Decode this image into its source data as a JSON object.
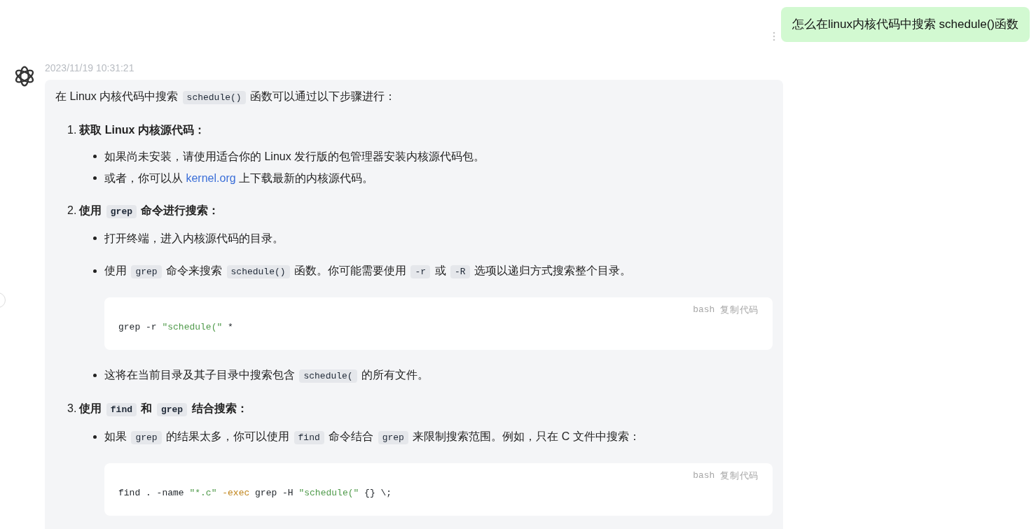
{
  "user_message": {
    "text": "怎么在linux内核代码中搜索 schedule()函数"
  },
  "assistant": {
    "timestamp": "2023/11/19 10:31:21",
    "intro": [
      {
        "kind": "text",
        "text": "在 Linux 内核代码中搜索 "
      },
      {
        "kind": "code",
        "text": "schedule()"
      },
      {
        "kind": "text",
        "text": " 函数可以通过以下步骤进行："
      }
    ],
    "steps": [
      {
        "number": "1.",
        "tight": true,
        "title": [
          {
            "kind": "text",
            "text": "获取 Linux 内核源代码："
          }
        ],
        "items": [
          {
            "kind": "bullet",
            "content": [
              {
                "kind": "text",
                "text": "如果尚未安装，请使用适合你的 Linux 发行版的包管理器安装内核源代码包。"
              }
            ]
          },
          {
            "kind": "bullet",
            "content": [
              {
                "kind": "text",
                "text": "或者，你可以从 "
              },
              {
                "kind": "link",
                "text": "kernel.org"
              },
              {
                "kind": "text",
                "text": " 上下载最新的内核源代码。"
              }
            ]
          }
        ]
      },
      {
        "number": "2.",
        "tight": false,
        "title": [
          {
            "kind": "text",
            "text": "使用 "
          },
          {
            "kind": "code",
            "text": "grep"
          },
          {
            "kind": "text",
            "text": " 命令进行搜索："
          }
        ],
        "items": [
          {
            "kind": "bullet",
            "content": [
              {
                "kind": "text",
                "text": "打开终端，进入内核源代码的目录。"
              }
            ]
          },
          {
            "kind": "bullet",
            "content": [
              {
                "kind": "text",
                "text": "使用 "
              },
              {
                "kind": "code",
                "text": "grep"
              },
              {
                "kind": "text",
                "text": " 命令来搜索 "
              },
              {
                "kind": "code",
                "text": "schedule()"
              },
              {
                "kind": "text",
                "text": " 函数。你可能需要使用 "
              },
              {
                "kind": "code",
                "text": "-r"
              },
              {
                "kind": "text",
                "text": " 或 "
              },
              {
                "kind": "code",
                "text": "-R"
              },
              {
                "kind": "text",
                "text": " 选项以递归方式搜索整个目录。"
              }
            ]
          },
          {
            "kind": "code_block",
            "language": "bash",
            "copy_label": "复制代码",
            "tokens": [
              {
                "kind": "plain",
                "text": "grep -r "
              },
              {
                "kind": "string",
                "text": "\"schedule(\""
              },
              {
                "kind": "plain",
                "text": " *"
              }
            ]
          },
          {
            "kind": "bullet",
            "content": [
              {
                "kind": "text",
                "text": "这将在当前目录及其子目录中搜索包含 "
              },
              {
                "kind": "code",
                "text": "schedule("
              },
              {
                "kind": "text",
                "text": " 的所有文件。"
              }
            ]
          }
        ]
      },
      {
        "number": "3.",
        "tight": false,
        "title": [
          {
            "kind": "text",
            "text": "使用 "
          },
          {
            "kind": "code",
            "text": "find"
          },
          {
            "kind": "text",
            "text": " 和 "
          },
          {
            "kind": "code",
            "text": "grep"
          },
          {
            "kind": "text",
            "text": " 结合搜索："
          }
        ],
        "items": [
          {
            "kind": "bullet",
            "content": [
              {
                "kind": "text",
                "text": "如果 "
              },
              {
                "kind": "code",
                "text": "grep"
              },
              {
                "kind": "text",
                "text": " 的结果太多，你可以使用 "
              },
              {
                "kind": "code",
                "text": "find"
              },
              {
                "kind": "text",
                "text": " 命令结合 "
              },
              {
                "kind": "code",
                "text": "grep"
              },
              {
                "kind": "text",
                "text": " 来限制搜索范围。例如，只在 C 文件中搜索："
              }
            ]
          },
          {
            "kind": "code_block",
            "language": "bash",
            "copy_label": "复制代码",
            "tokens": [
              {
                "kind": "plain",
                "text": "find . -name "
              },
              {
                "kind": "string",
                "text": "\"*.c\""
              },
              {
                "kind": "keyword",
                "text": " -exec"
              },
              {
                "kind": "plain",
                "text": " grep -H "
              },
              {
                "kind": "string",
                "text": "\"schedule(\""
              },
              {
                "kind": "plain",
                "text": " {} \\;"
              }
            ]
          }
        ]
      }
    ]
  }
}
